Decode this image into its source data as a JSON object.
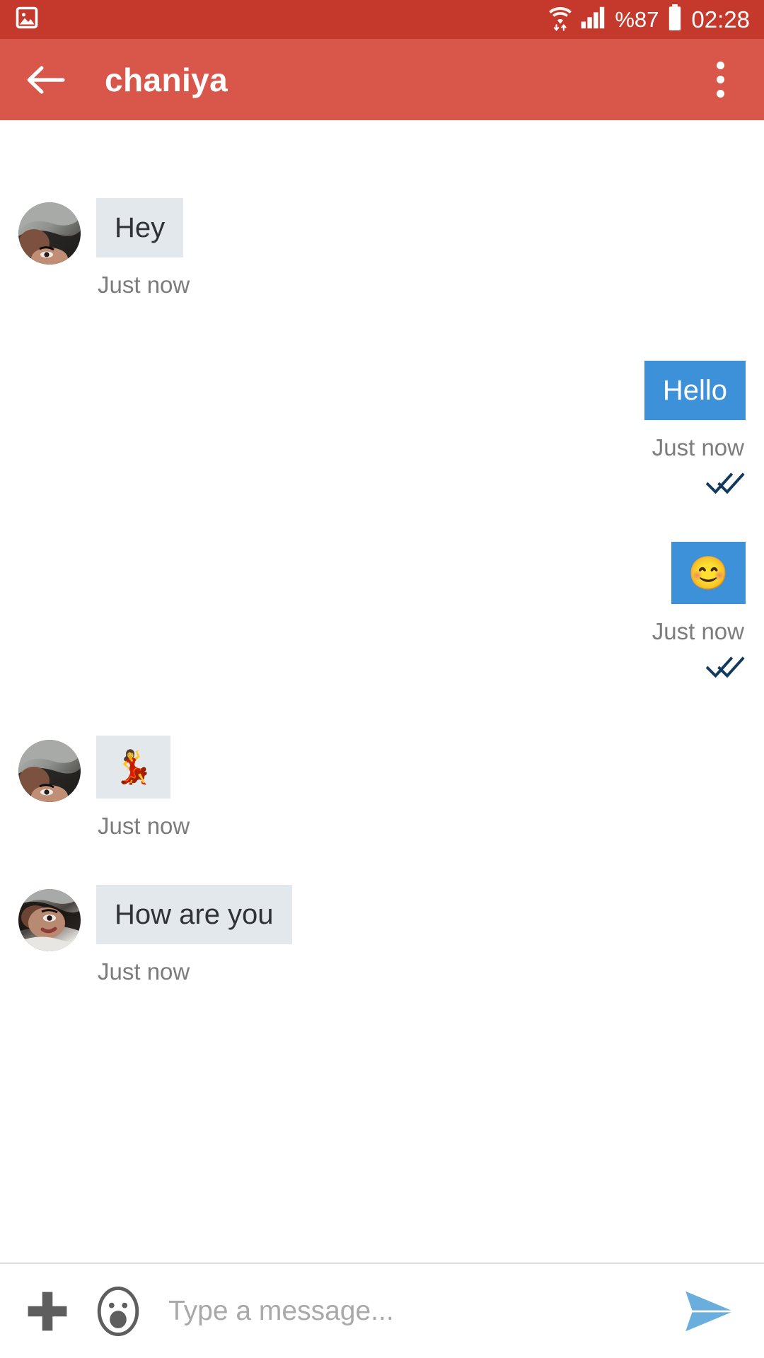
{
  "status_bar": {
    "background": "#c4392c",
    "left_icons": [
      "image-icon"
    ],
    "wifi_icon": "wifi-updown-icon",
    "signal_icon": "cellular-signal-icon",
    "battery_percent": "%87",
    "battery_icon": "battery-full-icon",
    "time": "02:28"
  },
  "app_bar": {
    "background": "#d9574a",
    "back_icon": "back-arrow-icon",
    "title": "chaniya",
    "overflow_icon": "more-vertical-icon"
  },
  "colors": {
    "accent_red": "#d9574a",
    "status_red": "#c4392c",
    "outgoing_bubble": "#3d91d8",
    "incoming_bubble": "#e3e8ed",
    "tick_blue": "#123a5e",
    "send_blue": "#6aaedd",
    "timestamp_gray": "#7c7c7c"
  },
  "messages": [
    {
      "id": "msg-1",
      "direction": "incoming",
      "sender": "chaniya",
      "text": "Hey",
      "timestamp": "Just now",
      "has_avatar": true,
      "type": "text"
    },
    {
      "id": "msg-2",
      "direction": "outgoing",
      "text": "Hello",
      "timestamp": "Just now",
      "status": "read",
      "status_icon": "double-check-icon",
      "type": "text"
    },
    {
      "id": "msg-3",
      "direction": "outgoing",
      "text": "😊",
      "timestamp": "Just now",
      "status": "read",
      "status_icon": "double-check-icon",
      "type": "emoji"
    },
    {
      "id": "msg-4",
      "direction": "incoming",
      "sender": "chaniya",
      "text": "💃",
      "timestamp": "Just now",
      "has_avatar": true,
      "type": "emoji"
    },
    {
      "id": "msg-5",
      "direction": "incoming",
      "sender": "chaniya",
      "text": "How are you",
      "timestamp": "Just now",
      "has_avatar": true,
      "type": "text"
    }
  ],
  "composer": {
    "attach_icon": "plus-icon",
    "emoji_icon": "emoji-face-icon",
    "input_placeholder": "Type a message...",
    "input_value": "",
    "send_icon": "send-paper-plane-icon"
  }
}
